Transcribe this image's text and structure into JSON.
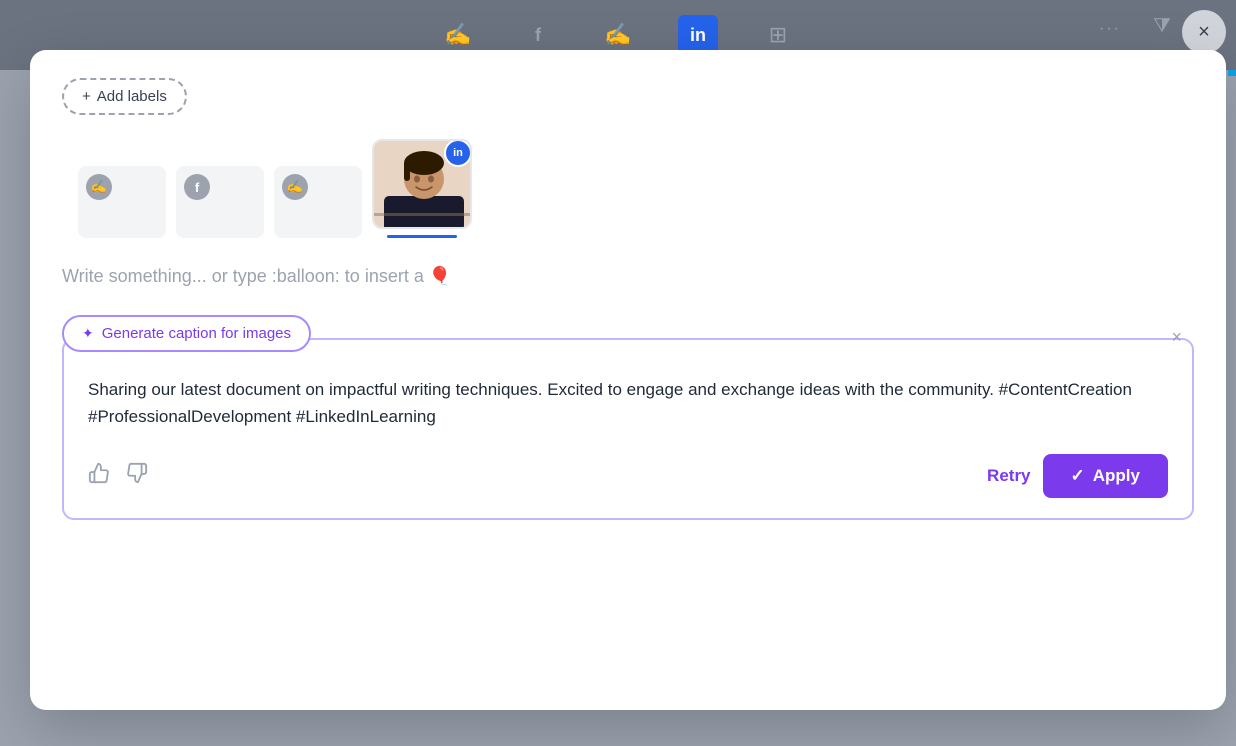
{
  "background": {
    "icons": [
      {
        "name": "feather-icon-1",
        "symbol": "✍",
        "active": false
      },
      {
        "name": "facebook-icon",
        "symbol": "f",
        "active": false
      },
      {
        "name": "feather-icon-2",
        "symbol": "✍",
        "active": false
      },
      {
        "name": "linkedin-icon",
        "symbol": "in",
        "active": true
      },
      {
        "name": "grid-icon",
        "symbol": "⊞",
        "active": false
      }
    ],
    "close_label": "×",
    "dots_label": "···"
  },
  "modal": {
    "add_labels": {
      "icon": "+",
      "label": "Add labels"
    },
    "platforms": [
      {
        "name": "feather-platform",
        "badge": "✍"
      },
      {
        "name": "facebook-platform",
        "badge": "f"
      },
      {
        "name": "feather-platform-2",
        "badge": "✍"
      }
    ],
    "linkedin_active": {
      "badge": "in",
      "underline": true
    },
    "write_placeholder": "Write something... or type :balloon: to insert a 🎈",
    "generate_caption": {
      "sparkle": "✦",
      "label": "Generate caption for images"
    },
    "caption_text": "Sharing our latest document on impactful writing techniques. Excited to engage and exchange ideas with the community. #ContentCreation #ProfessionalDevelopment #LinkedInLearning",
    "close_caption": "×",
    "thumbs_up": "👍",
    "thumbs_down": "👎",
    "retry_label": "Retry",
    "apply_label": "Apply",
    "apply_check": "✓"
  }
}
